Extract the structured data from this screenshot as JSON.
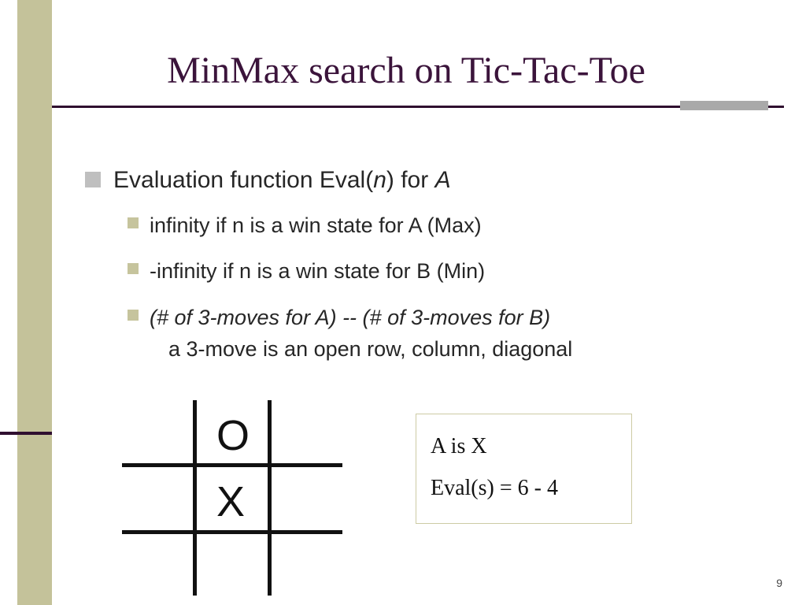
{
  "title": "MinMax search on Tic-Tac-Toe",
  "bullets": {
    "main_pre": "Evaluation function Eval(",
    "main_n": "n",
    "main_mid": ") for ",
    "main_A": "A",
    "sub1": "infinity if n is a win state for A (Max)",
    "sub2": "-infinity if n is a win state for B (Min)",
    "sub3_ital": "(# of 3-moves for A) -- (# of 3-moves for B)",
    "sub3_line2": "a 3-move is an open row, column, diagonal"
  },
  "board": {
    "top_mid": "O",
    "center": "X"
  },
  "note": {
    "line1": "A is X",
    "line2": "Eval(s) = 6 - 4"
  },
  "pagenum": "9"
}
